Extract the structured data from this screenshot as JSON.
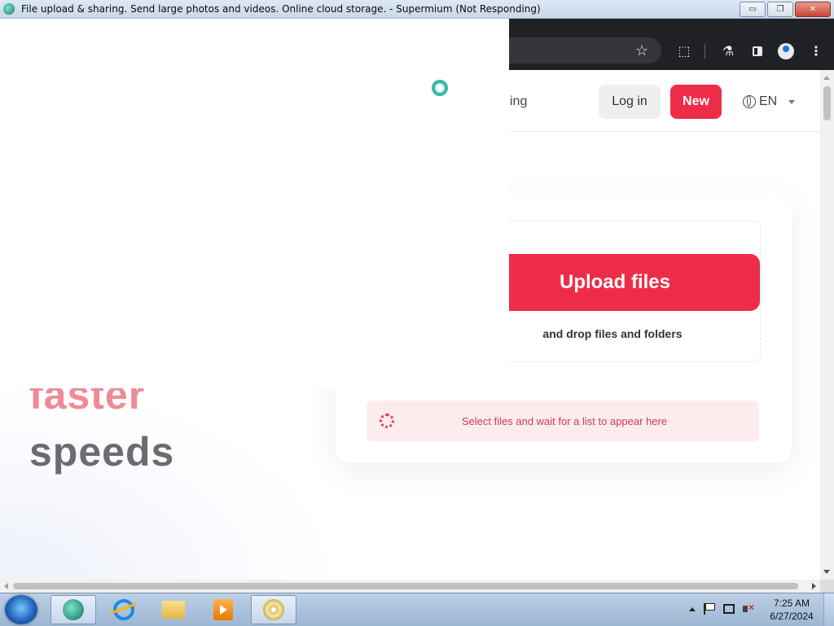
{
  "window": {
    "title": "File upload & sharing. Send large photos and videos. Online cloud storage. - Supermium (Not Responding)",
    "controls": {
      "minimize": "▭",
      "restore": "❐",
      "close": "✕"
    }
  },
  "browser": {
    "toolbar_icons": [
      "star-icon",
      "puzzle-icon",
      "flask-icon",
      "sidepanel-icon",
      "profile-icon",
      "menu-icon"
    ],
    "star_glyph": "☆",
    "puzzle_glyph": "⬚",
    "flask_glyph": "⚗",
    "menu_glyph": "⋮"
  },
  "site": {
    "nav_partial": "ing",
    "login_label": "Log in",
    "new_label": "New",
    "language": "EN",
    "upload_button": "Upload files",
    "drop_hint": "and drop files and folders",
    "wait_message": "Select files and wait for a list to appear here",
    "hero_line_1": "faster",
    "hero_line_2": "speeds",
    "accent_color": "#ed2d48"
  },
  "taskbar": {
    "items": [
      "supermium-icon",
      "ie-icon",
      "folder-icon",
      "media-player-icon",
      "dvd-icon"
    ],
    "clock_time": "7:25 AM",
    "clock_date": "6/27/2024"
  }
}
